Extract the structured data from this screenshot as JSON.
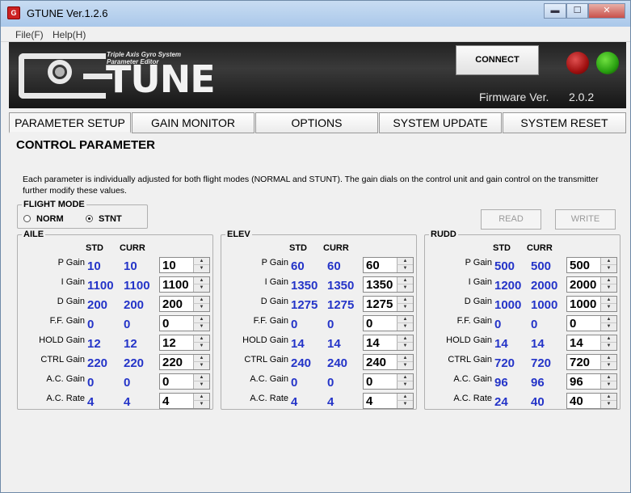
{
  "window": {
    "title": "GTUNE Ver.1.2.6",
    "icon_text": "G",
    "min_glyph": "▬",
    "max_glyph": "☐",
    "close_glyph": "✕"
  },
  "menu": [
    {
      "label": "File(F)"
    },
    {
      "label": "Help(H)"
    }
  ],
  "banner": {
    "logo_text": "TUNE",
    "tagline_1": "Triple Axis Gyro System",
    "tagline_2": "Parameter Editor",
    "connect_label": "CONNECT",
    "firmware_label": "Firmware Ver.",
    "firmware_value": "2.0.2",
    "status_colors": {
      "red": "#a01010",
      "green": "#28a010"
    }
  },
  "tabs": [
    {
      "label": "PARAMETER SETUP",
      "active": true
    },
    {
      "label": "GAIN MONITOR"
    },
    {
      "label": "OPTIONS"
    },
    {
      "label": "SYSTEM UPDATE"
    },
    {
      "label": "SYSTEM RESET"
    }
  ],
  "section_title": "CONTROL PARAMETER",
  "description": "Each parameter is individually adjusted for both flight modes (NORMAL and STUNT). The gain dials on the control unit and gain control on the transmitter further modify these values.",
  "flight_mode": {
    "label": "FLIGHT MODE",
    "options": [
      "NORM",
      "STNT"
    ],
    "selected": "STNT"
  },
  "read_label": "READ",
  "write_label": "WRITE",
  "col_std": "STD",
  "col_curr": "CURR",
  "param_labels": [
    "P Gain",
    "I Gain",
    "D Gain",
    "F.F. Gain",
    "HOLD Gain",
    "CTRL Gain",
    "A.C. Gain",
    "A.C. Rate"
  ],
  "groups": [
    {
      "name": "AILE",
      "std": [
        "10",
        "1100",
        "200",
        "0",
        "12",
        "220",
        "0",
        "4"
      ],
      "curr": [
        "10",
        "1100",
        "200",
        "0",
        "12",
        "220",
        "0",
        "4"
      ],
      "input": [
        "10",
        "1100",
        "200",
        "0",
        "12",
        "220",
        "0",
        "4"
      ]
    },
    {
      "name": "ELEV",
      "std": [
        "60",
        "1350",
        "1275",
        "0",
        "14",
        "240",
        "0",
        "4"
      ],
      "curr": [
        "60",
        "1350",
        "1275",
        "0",
        "14",
        "240",
        "0",
        "4"
      ],
      "input": [
        "60",
        "1350",
        "1275",
        "0",
        "14",
        "240",
        "0",
        "4"
      ]
    },
    {
      "name": "RUDD",
      "std": [
        "500",
        "1200",
        "1000",
        "0",
        "14",
        "720",
        "96",
        "24"
      ],
      "curr": [
        "500",
        "2000",
        "1000",
        "0",
        "14",
        "720",
        "96",
        "40"
      ],
      "input": [
        "500",
        "2000",
        "1000",
        "0",
        "14",
        "720",
        "96",
        "40"
      ]
    }
  ],
  "colors": {
    "value_blue": "#2434c8"
  }
}
